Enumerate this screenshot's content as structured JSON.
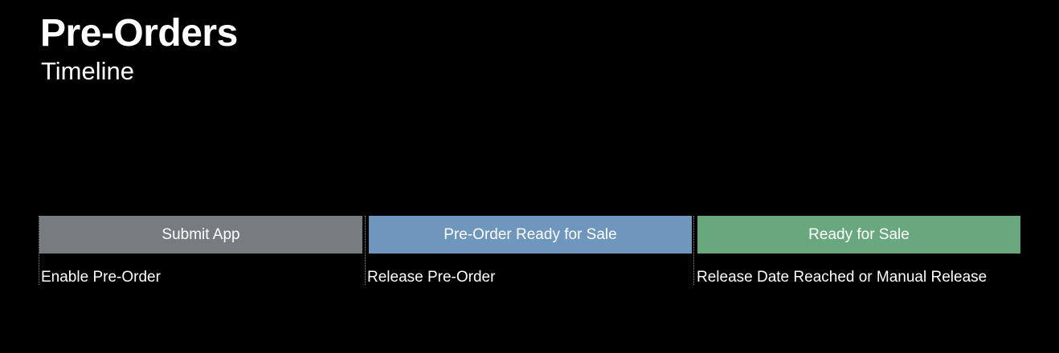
{
  "header": {
    "title": "Pre-Orders",
    "subtitle": "Timeline"
  },
  "stages": [
    {
      "label": "Submit App",
      "action": "Enable Pre-Order",
      "color": "#777c81"
    },
    {
      "label": "Pre-Order Ready for Sale",
      "action": "Release Pre-Order",
      "color": "#6f96bd"
    },
    {
      "label": "Ready for Sale",
      "action": "Release Date Reached or Manual Release",
      "color": "#69a87e"
    }
  ]
}
